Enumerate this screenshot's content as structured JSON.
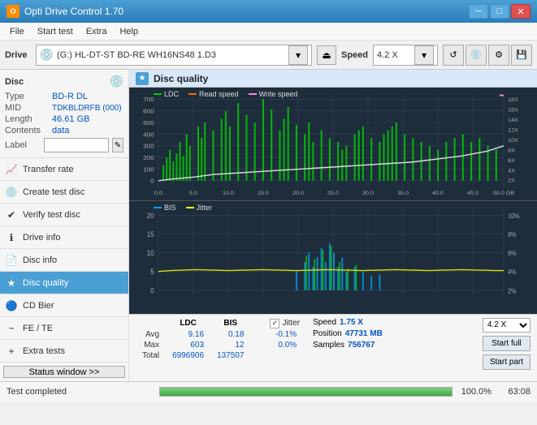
{
  "window": {
    "title": "Opti Drive Control 1.70",
    "icon": "O"
  },
  "menu": {
    "items": [
      "File",
      "Start test",
      "Extra",
      "Help"
    ]
  },
  "drive_bar": {
    "label": "Drive",
    "drive_value": "(G:) HL-DT-ST BD-RE  WH16NS48 1.D3",
    "speed_label": "Speed",
    "speed_value": "4.2 X"
  },
  "disc_section": {
    "title": "Disc",
    "type_label": "Type",
    "type_value": "BD-R DL",
    "mid_label": "MID",
    "mid_value": "TDKBLDRFB (000)",
    "length_label": "Length",
    "length_value": "46.61 GB",
    "contents_label": "Contents",
    "contents_value": "data",
    "label_label": "Label",
    "label_placeholder": ""
  },
  "nav": {
    "items": [
      {
        "id": "transfer-rate",
        "label": "Transfer rate",
        "icon": "📈"
      },
      {
        "id": "create-test-disc",
        "label": "Create test disc",
        "icon": "💿"
      },
      {
        "id": "verify-test-disc",
        "label": "Verify test disc",
        "icon": "✔"
      },
      {
        "id": "drive-info",
        "label": "Drive info",
        "icon": "ℹ"
      },
      {
        "id": "disc-info",
        "label": "Disc info",
        "icon": "📄"
      },
      {
        "id": "disc-quality",
        "label": "Disc quality",
        "icon": "★",
        "active": true
      },
      {
        "id": "cd-bier",
        "label": "CD Bier",
        "icon": "🔵"
      },
      {
        "id": "fe-te",
        "label": "FE / TE",
        "icon": "~"
      },
      {
        "id": "extra-tests",
        "label": "Extra tests",
        "icon": "+"
      }
    ],
    "status_btn": "Status window >>"
  },
  "disc_quality": {
    "title": "Disc quality",
    "legend_top": {
      "ldc": "LDC",
      "read": "Read speed",
      "write": "Write speed"
    },
    "legend_bottom": {
      "bis": "BIS",
      "jitter": "Jitter"
    },
    "y_axis_top_labels": [
      "700",
      "600",
      "500",
      "400",
      "300",
      "200",
      "100",
      "0"
    ],
    "y_axis_top_right": [
      "18X",
      "16X",
      "14X",
      "12X",
      "10X",
      "8X",
      "6X",
      "4X",
      "2X"
    ],
    "y_axis_bottom_labels": [
      "20",
      "15",
      "10",
      "5",
      "0"
    ],
    "y_axis_bottom_right": [
      "10%",
      "8%",
      "6%",
      "4%",
      "2%"
    ],
    "x_axis": [
      "0.0",
      "5.0",
      "10.0",
      "15.0",
      "20.0",
      "25.0",
      "30.0",
      "35.0",
      "40.0",
      "45.0",
      "50.0 GB"
    ],
    "stats": {
      "columns": [
        "",
        "LDC",
        "BIS",
        "",
        "Jitter",
        "Speed",
        ""
      ],
      "avg_label": "Avg",
      "avg_ldc": "9.16",
      "avg_bis": "0.18",
      "avg_jitter": "-0.1%",
      "max_label": "Max",
      "max_ldc": "603",
      "max_bis": "12",
      "max_jitter": "0.0%",
      "total_label": "Total",
      "total_ldc": "6996906",
      "total_bis": "137507",
      "speed_label": "Speed",
      "speed_value": "1.75 X",
      "position_label": "Position",
      "position_value": "47731 MB",
      "samples_label": "Samples",
      "samples_value": "756767",
      "jitter_checked": true,
      "speed_select": "4.2 X",
      "start_full": "Start full",
      "start_part": "Start part"
    }
  },
  "bottom_bar": {
    "status": "Test completed",
    "progress": 100,
    "progress_text": "100.0%",
    "value": "63:08"
  }
}
